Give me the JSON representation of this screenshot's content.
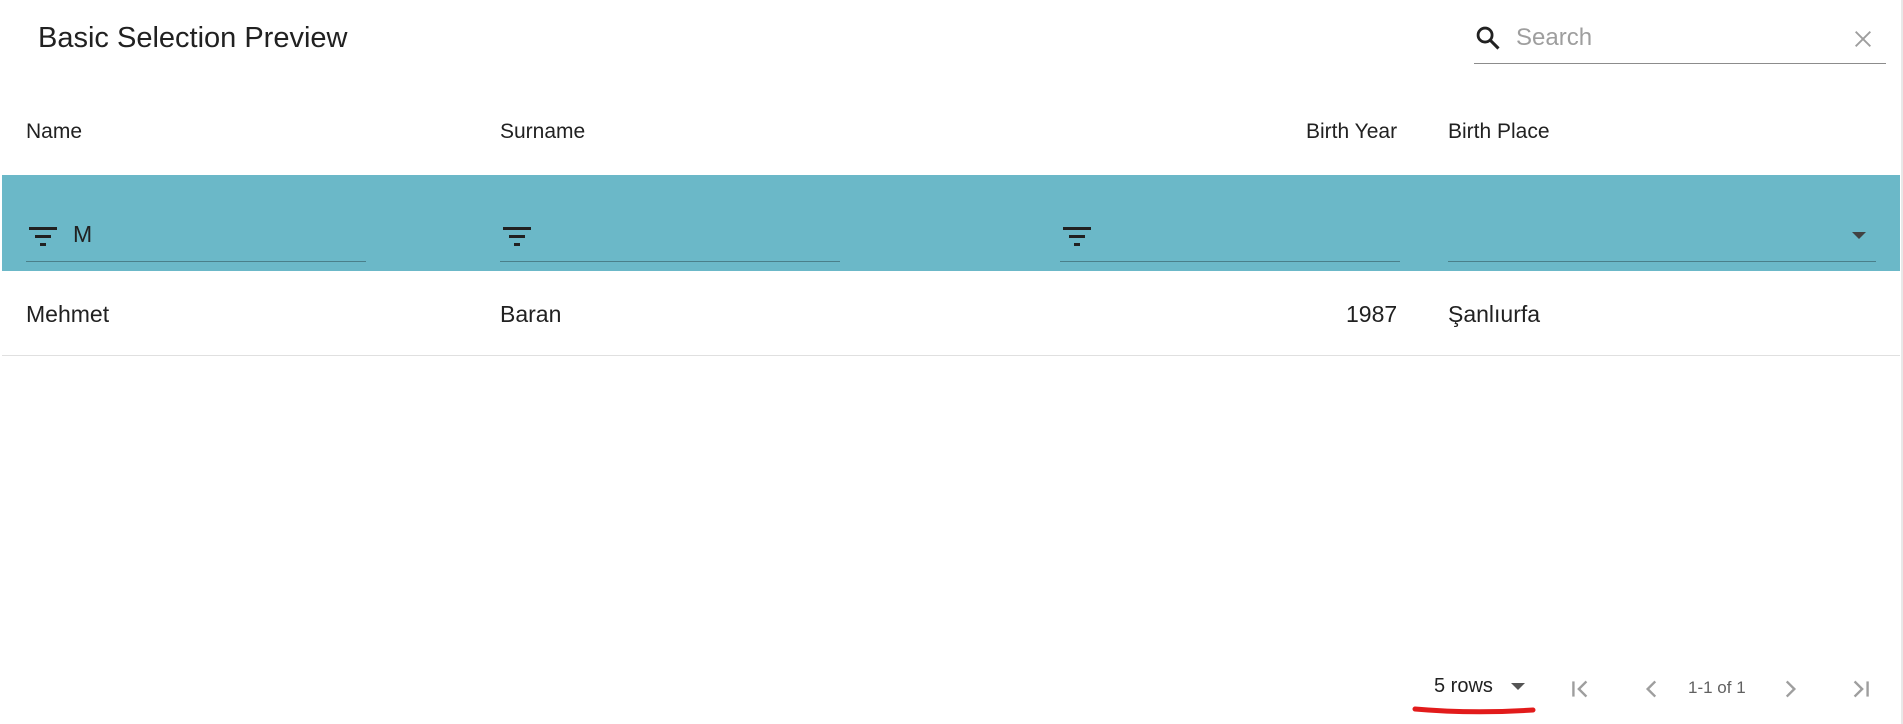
{
  "app": {
    "title": "Basic Selection Preview"
  },
  "search": {
    "placeholder": "Search",
    "value": ""
  },
  "columns": [
    "Name",
    "Surname",
    "Birth Year",
    "Birth Place"
  ],
  "filters": {
    "name": "M",
    "surname": "",
    "birth_year": "",
    "birth_place": ""
  },
  "rows": [
    {
      "name": "Mehmet",
      "surname": "Baran",
      "birth_year": "1987",
      "birth_place": "Şanlıurfa"
    }
  ],
  "pagination": {
    "rows_per_page": "5 rows",
    "range": "1-1 of 1"
  },
  "colors": {
    "filter_row_bg": "#6bb8c8",
    "annotation": "#e21b1b"
  },
  "icons": [
    "search-icon",
    "clear-icon",
    "filter-icon",
    "dropdown-caret-icon",
    "first-page-icon",
    "previous-page-icon",
    "next-page-icon",
    "last-page-icon"
  ]
}
